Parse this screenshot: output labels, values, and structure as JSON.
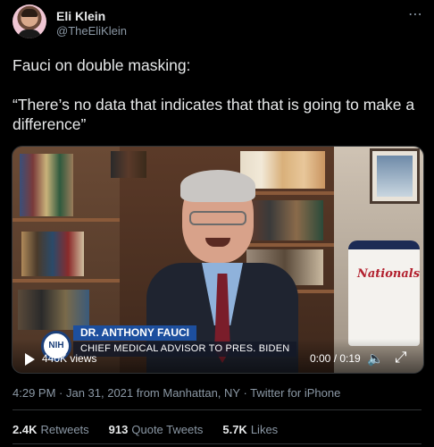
{
  "author": {
    "name": "Eli Klein",
    "handle": "@TheEliKlein"
  },
  "more_icon": "more-horizontal-icon",
  "tweet": {
    "line1": "Fauci on double masking:",
    "line2": "“There’s no data that indicates that that is going to make a difference”"
  },
  "video": {
    "lower_third_badge": "NIH",
    "lower_third_name": "DR. ANTHONY FAUCI",
    "lower_third_title": "CHIEF MEDICAL ADVISOR TO PRES. BIDEN",
    "jersey_text": "Nationals",
    "views": "440K views",
    "time": "0:00 / 0:19",
    "progress": 0
  },
  "meta": "4:29 PM · Jan 31, 2021 from Manhattan, NY · Twitter for iPhone",
  "stats": {
    "retweets_count": "2.4K",
    "retweets_label": "Retweets",
    "quotes_count": "913",
    "quotes_label": "Quote Tweets",
    "likes_count": "5.7K",
    "likes_label": "Likes"
  },
  "colors": {
    "background": "#000000",
    "text": "#e7e9ea",
    "muted": "#8b98a5",
    "divider": "#2f3336",
    "lower_third_blue": "#1d4f9e"
  }
}
